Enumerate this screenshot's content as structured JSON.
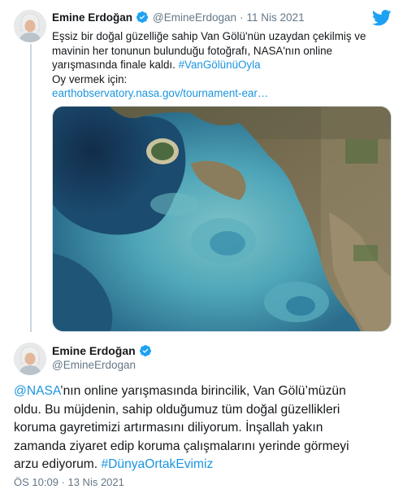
{
  "colors": {
    "link": "#1b95e0",
    "verified": "#1da1f2",
    "twitter_bird": "#1da1f2",
    "secondary_text": "#657786"
  },
  "quoted_tweet": {
    "author_name": "Emine Erdoğan",
    "handle": "@EmineErdogan",
    "separator": "·",
    "date": "11 Nis 2021",
    "text_lines": [
      "Eşsiz bir doğal güzelliğe sahip Van Gölü'nün uzaydan çekilmiş ve",
      "mavinin her tonunun bulunduğu fotoğrafı, NASA'nın online",
      "yarışmasında finale kaldı. "
    ],
    "hashtag": "#VanGölünüOyla",
    "vote_line": "Oy vermek için:",
    "link": "earthobservatory.nasa.gov/tournament-ear…",
    "image_icon": "satellite-photo-van-lake",
    "logo_icon": "twitter-bird-icon"
  },
  "main_tweet": {
    "author_name": "Emine Erdoğan",
    "handle": "@EmineErdogan",
    "mention": "@NASA",
    "line1_rest": "’nın online yarışmasında birincilik, Van Gölü’müzün",
    "line2": "oldu. Bu müjdenin, sahip olduğumuz tüm doğal güzellikleri",
    "line3": "koruma gayretimizi artırmasını diliyorum. İnşallah yakın",
    "line4": "zamanda ziyaret edip koruma çalışmalarını yerinde görmeyi",
    "line5_start": "arzu ediyorum. ",
    "hashtag": "#DünyaOrtakEvimiz",
    "timestamp": "ÖS 10:09 · 13 Nis 2021"
  }
}
